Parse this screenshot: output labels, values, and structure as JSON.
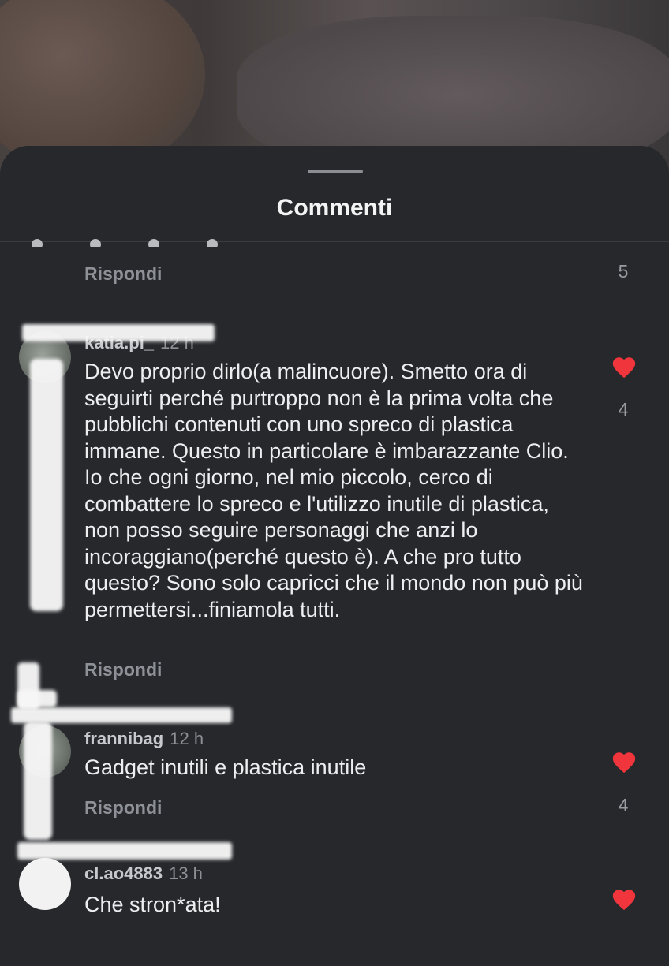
{
  "sheet": {
    "title": "Commenti"
  },
  "previous_comment": {
    "reply_label": "Rispondi",
    "likes": "5"
  },
  "comments": [
    {
      "username": "katia.pi_",
      "time": "12 h",
      "text": "Devo proprio dirlo(a malincuore). Smetto ora di seguirti perché purtroppo non è la prima volta che pubblichi contenuti con uno spreco di plastica immane. Questo in particolare è imbarazzante Clio. Io che ogni giorno, nel mio piccolo, cerco di combattere lo spreco e l'utilizzo inutile di plastica, non posso seguire personaggi che anzi lo incoraggiano(perché questo è). A che pro tutto questo? Sono solo capricci che il mondo non può più permettersi...finiamola tutti.",
      "reply_label": "Rispondi",
      "likes": "4",
      "liked": true
    },
    {
      "username": "frannibag",
      "time": "12 h",
      "text": "Gadget inutili e plastica inutile",
      "reply_label": "Rispondi",
      "likes": "4",
      "liked": true
    },
    {
      "username": "cl.ao4883",
      "time": "13 h",
      "text": "Che stron*ata!",
      "reply_label": "",
      "likes": "",
      "liked": true
    }
  ],
  "colors": {
    "heart": "#f0353c",
    "sheet_bg": "#26282c",
    "text": "#eeeef0",
    "muted": "#8e9197"
  },
  "icons": {
    "heart": "heart-icon",
    "avatar": "avatar"
  }
}
